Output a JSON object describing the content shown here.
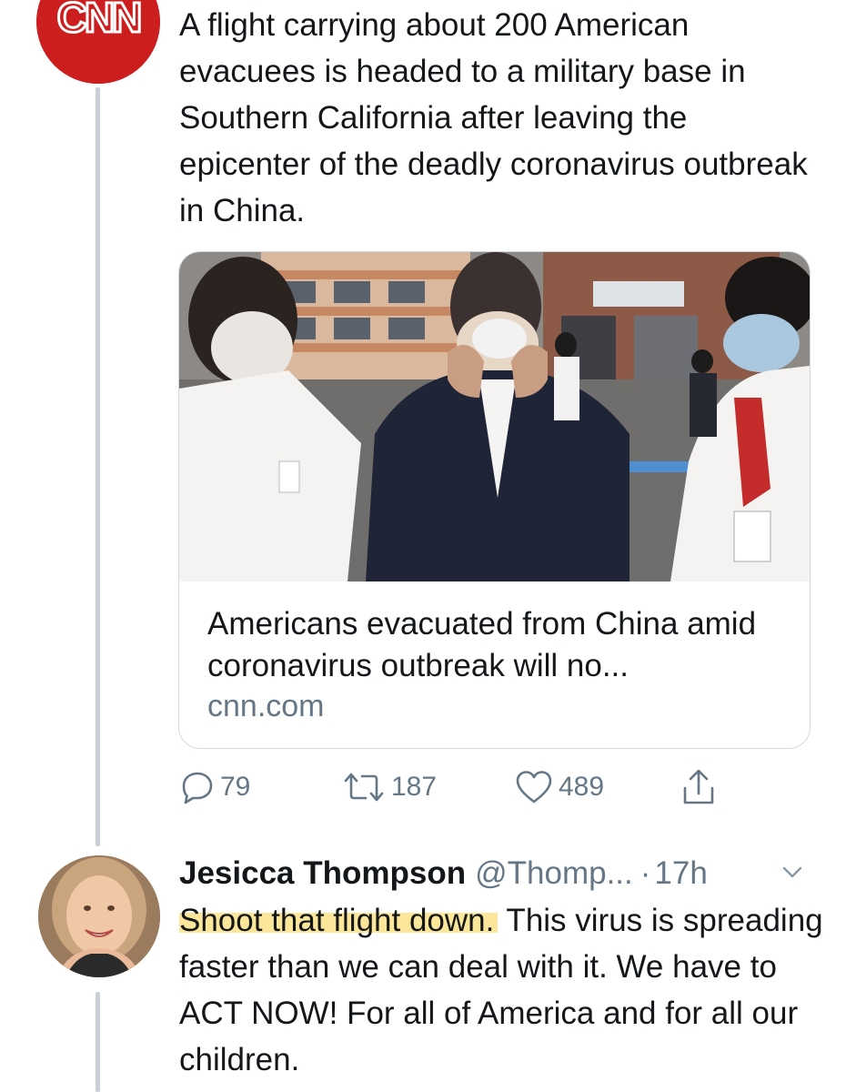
{
  "tweet1": {
    "author_logo": "CNN",
    "text": "A flight carrying about 200 American evacuees is headed to a military base in Southern California after leaving the epicenter of the deadly coronavirus outbreak in China.",
    "card": {
      "image_icon": "photo-men-in-masks",
      "title": "Americans evacuated from China amid coronavirus outbreak will no...",
      "domain": "cnn.com"
    },
    "actions": {
      "reply_count": "79",
      "retweet_count": "187",
      "like_count": "489"
    }
  },
  "tweet2": {
    "author": "Jesicca Thompson",
    "handle": "@Thomp...",
    "separator": "·",
    "time": "17h",
    "text_highlighted": "Shoot that flight down.",
    "text_rest": " This virus is spreading faster than we can deal with it. We have to ACT NOW! For all of America and for all our children."
  },
  "colors": {
    "text": "#14171a",
    "secondary": "#657786",
    "highlight": "#fbe69a",
    "cnn_red": "#cc1e1e",
    "thread_line": "#c8d0d6"
  }
}
